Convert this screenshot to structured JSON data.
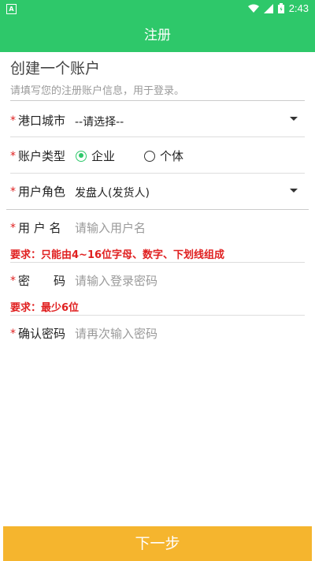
{
  "status_bar": {
    "time": "2:43",
    "left_icon": "A"
  },
  "header": {
    "title": "注册"
  },
  "intro": {
    "title": "创建一个账户",
    "subtitle": "请填写您的注册账户信息，用于登录。"
  },
  "form": {
    "required_mark": "*",
    "port_city": {
      "label": "港口城市",
      "value": "--请选择--"
    },
    "account_type": {
      "label": "账户类型",
      "options": [
        "企业",
        "个体"
      ],
      "selected": "企业"
    },
    "user_role": {
      "label": "用户角色",
      "value": "发盘人(发货人)"
    },
    "username": {
      "label": "用 户 名",
      "placeholder": "请输入用户名",
      "hint": "要求：只能由4~16位字母、数字、下划线组成"
    },
    "password": {
      "label": "密　　码",
      "placeholder": "请输入登录密码",
      "hint": "要求：最少6位"
    },
    "confirm_password": {
      "label": "确认密码",
      "placeholder": "请再次输入密码"
    }
  },
  "footer": {
    "next_label": "下一步"
  },
  "colors": {
    "primary": "#2ec86a",
    "button": "#f5b52e",
    "required": "#e02020"
  }
}
